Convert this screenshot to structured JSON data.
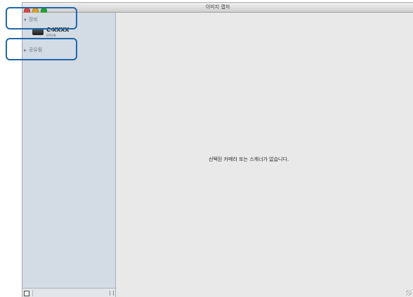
{
  "window": {
    "title": "이미지 캡처"
  },
  "sidebar": {
    "devices_header": "장비",
    "device": {
      "name": "C-XXXX",
      "sub": "EPSON",
      "icon": "scanner-icon"
    },
    "shared_header": "공유됨"
  },
  "main": {
    "empty_message": "선택된 카메라 또는 스캐너가 없습니다."
  },
  "colors": {
    "sidebar_bg": "#d3dbe5",
    "highlight": "#1f67a9"
  }
}
